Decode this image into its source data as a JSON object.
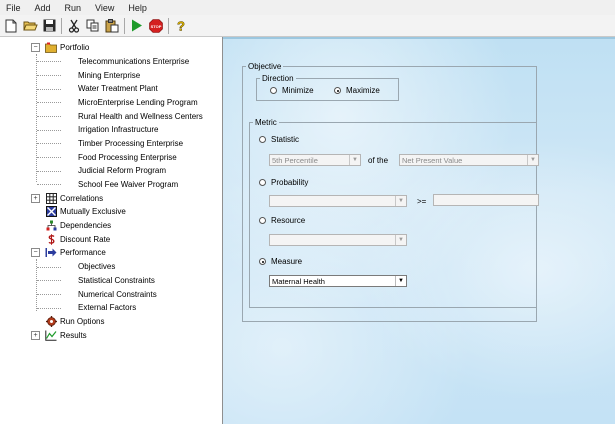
{
  "menu": [
    "File",
    "Add",
    "Run",
    "View",
    "Help"
  ],
  "toolbar": {
    "icons": [
      "new-file-icon",
      "open-folder-icon",
      "save-icon",
      "cut-icon",
      "copy-icon",
      "paste-icon",
      "run-icon",
      "stop-icon",
      "help-icon"
    ],
    "stop_label": "STOP",
    "help_label": "?"
  },
  "tree": {
    "portfolio": "Portfolio",
    "projects": [
      "Telecommunications Enterprise",
      "Mining Enterprise",
      "Water Treatment Plant",
      "MicroEnterprise Lending Program",
      "Rural Health and Wellness Centers",
      "Irrigation Infrastructure",
      "Timber Processing Enterprise",
      "Food Processing Enterprise",
      "Judicial Reform Program",
      "School Fee Waiver Program"
    ],
    "correlations": "Correlations",
    "mutually_exclusive": "Mutually Exclusive",
    "dependencies": "Dependencies",
    "discount_rate": "Discount Rate",
    "performance": "Performance",
    "performance_children": [
      "Objectives",
      "Statistical Constraints",
      "Numerical Constraints",
      "External Factors"
    ],
    "run_options": "Run Options",
    "results": "Results"
  },
  "objective": {
    "title": "Objective",
    "direction": {
      "title": "Direction",
      "minimize": "Minimize",
      "maximize": "Maximize",
      "selected": "Maximize"
    },
    "metric": {
      "title": "Metric",
      "statistic_label": "Statistic",
      "statistic_value": "5th Percentile",
      "of_the": "of the",
      "statistic_target": "Net Present Value",
      "probability_label": "Probability",
      "probability_value": "",
      "gte": ">=",
      "resource_label": "Resource",
      "resource_value": "",
      "measure_label": "Measure",
      "measure_value": "Maternal Health",
      "selected": "Measure"
    }
  },
  "colors": {
    "panel_bg": "#c4e2f5",
    "portfolio_folder": "#e0b030",
    "stop_red": "#d42020",
    "run_green": "#1d9b2a"
  }
}
